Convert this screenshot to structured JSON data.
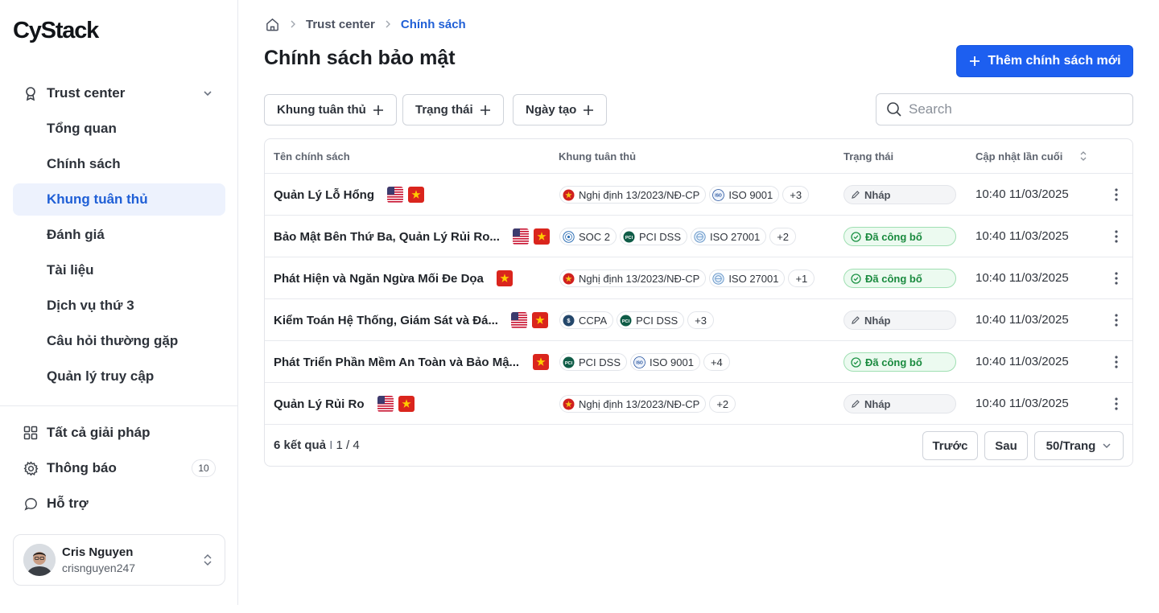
{
  "brand": {
    "logo_text": "CyStack"
  },
  "sidebar": {
    "group": {
      "label": "Trust center",
      "icon": "badge-icon",
      "expanded": true
    },
    "items": [
      {
        "label": "Tổng quan",
        "active": false
      },
      {
        "label": "Chính sách",
        "active": false
      },
      {
        "label": "Khung tuân thủ",
        "active": true
      },
      {
        "label": "Đánh giá",
        "active": false
      },
      {
        "label": "Tài liệu",
        "active": false
      },
      {
        "label": "Dịch vụ thứ 3",
        "active": false
      },
      {
        "label": "Câu hỏi thường gặp",
        "active": false
      },
      {
        "label": "Quản lý truy cập",
        "active": false
      }
    ],
    "bottom": [
      {
        "label": "Tất cả giải pháp",
        "icon": "grid-icon"
      },
      {
        "label": "Thông báo",
        "icon": "gear-icon",
        "count": "10"
      },
      {
        "label": "Hỗ trợ",
        "icon": "chat-icon"
      }
    ],
    "user": {
      "name": "Cris Nguyen",
      "handle": "crisnguyen247"
    }
  },
  "breadcrumb": {
    "parent": "Trust center",
    "current": "Chính sách"
  },
  "page": {
    "title": "Chính sách bảo mật",
    "add_button": "Thêm chính sách mới"
  },
  "filters": {
    "framework": "Khung tuân thủ",
    "status": "Trạng thái",
    "created": "Ngày tạo",
    "search_placeholder": "Search"
  },
  "table": {
    "headers": {
      "name": "Tên chính sách",
      "framework": "Khung tuân thủ",
      "status": "Trạng thái",
      "updated": "Cập nhật lần cuối"
    },
    "rows": [
      {
        "name": "Quản Lý Lỗ Hổng",
        "flags": [
          "us",
          "vn"
        ],
        "frameworks": [
          {
            "label": "Nghị định 13/2023/NĐ-CP",
            "icon": "vn-emblem-icon"
          },
          {
            "label": "ISO 9001",
            "icon": "iso-icon"
          }
        ],
        "more": "+3",
        "status": "Nháp",
        "status_type": "draft",
        "updated": "10:40 11/03/2025"
      },
      {
        "name": "Bảo Mật Bên Thứ Ba, Quản Lý Rủi Ro...",
        "flags": [
          "us",
          "vn"
        ],
        "frameworks": [
          {
            "label": "SOC 2",
            "icon": "soc-icon"
          },
          {
            "label": "PCI DSS",
            "icon": "pci-icon"
          },
          {
            "label": "ISO 27001",
            "icon": "iso-globe-icon"
          }
        ],
        "more": "+2",
        "status": "Đã công bố",
        "status_type": "published",
        "updated": "10:40 11/03/2025"
      },
      {
        "name": "Phát Hiện và Ngăn Ngừa Mối Đe Dọa",
        "flags": [
          "vn"
        ],
        "frameworks": [
          {
            "label": "Nghị định 13/2023/NĐ-CP",
            "icon": "vn-emblem-icon"
          },
          {
            "label": "ISO 27001",
            "icon": "iso-globe-icon"
          }
        ],
        "more": "+1",
        "status": "Đã công bố",
        "status_type": "published",
        "updated": "10:40 11/03/2025"
      },
      {
        "name": "Kiểm Toán Hệ Thống, Giám Sát và Đá...",
        "flags": [
          "us",
          "vn"
        ],
        "frameworks": [
          {
            "label": "CCPA",
            "icon": "ccpa-icon"
          },
          {
            "label": "PCI DSS",
            "icon": "pci-icon"
          }
        ],
        "more": "+3",
        "status": "Nháp",
        "status_type": "draft",
        "updated": "10:40 11/03/2025"
      },
      {
        "name": "Phát Triển Phần Mềm An Toàn và Bảo Mậ...",
        "flags": [
          "vn"
        ],
        "frameworks": [
          {
            "label": "PCI DSS",
            "icon": "pci-icon"
          },
          {
            "label": "ISO 9001",
            "icon": "iso-icon"
          }
        ],
        "more": "+4",
        "status": "Đã công bố",
        "status_type": "published",
        "updated": "10:40 11/03/2025"
      },
      {
        "name": "Quản Lý Rủi Ro",
        "flags": [
          "us",
          "vn"
        ],
        "frameworks": [
          {
            "label": "Nghị định 13/2023/NĐ-CP",
            "icon": "vn-emblem-icon"
          }
        ],
        "more": "+2",
        "status": "Nháp",
        "status_type": "draft",
        "updated": "10:40 11/03/2025"
      }
    ]
  },
  "pagination": {
    "results_count": "6 kết quả",
    "separator": "I",
    "page_info": "1 / 4",
    "prev": "Trước",
    "next": "Sau",
    "page_size": "50/Trang"
  },
  "colors": {
    "primary": "#1d5ff0",
    "active_bg": "#edf2fd",
    "published_bg": "#ecfaf0",
    "published_text": "#198a3e"
  }
}
